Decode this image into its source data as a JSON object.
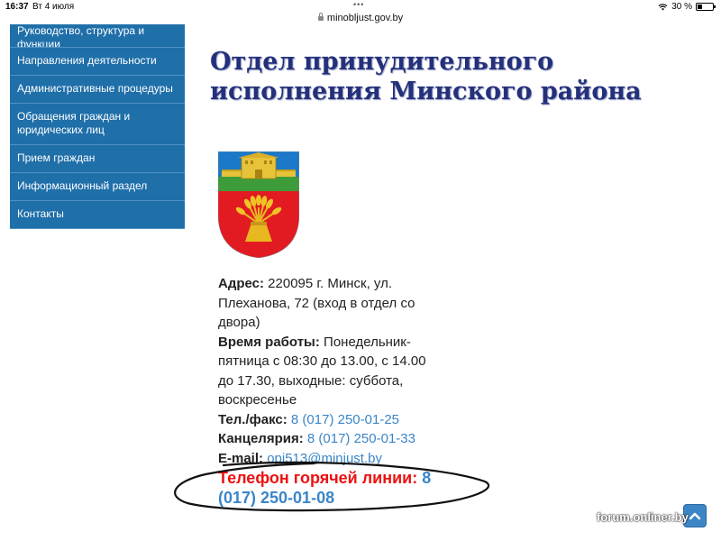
{
  "status_bar": {
    "time": "16:37",
    "date": "Вт 4 июля",
    "battery": "30 %",
    "battery_level": 0.3
  },
  "browser": {
    "url": "minobljust.gov.by"
  },
  "sidebar": {
    "items": [
      {
        "label": "Руководство, структура и функции"
      },
      {
        "label": "Направления деятельности"
      },
      {
        "label": "Административные процедуры"
      },
      {
        "label": "Обращения граждан и юридических лиц"
      },
      {
        "label": "Прием граждан"
      },
      {
        "label": "Информационный раздел"
      },
      {
        "label": "Контакты"
      }
    ]
  },
  "page": {
    "title": "Отдел принудительного исполнения Минского района",
    "address": {
      "label": "Адрес:",
      "value": "220095 г. Минск, ул. Плеханова, 72 (вход в отдел со двора)"
    },
    "hours": {
      "label": "Время работы:",
      "value": "Понедельник-пятница с 08:30 до 13.00, с 14.00 до 17.30, выходные: суббота, воскресенье"
    },
    "phone_fax": {
      "label": "Тел./факс:",
      "value": "8 (017) 250-01-25"
    },
    "office": {
      "label": "Канцелярия:",
      "value": "8 (017) 250-01-33"
    },
    "email": {
      "label": "E-mail:",
      "value": "opi513@minjust.by"
    },
    "hotline": {
      "label": "Телефон горячей линии:",
      "value": "8 (017) 250-01-08"
    }
  },
  "watermark": "forum.onliner.by",
  "colors": {
    "sidebar": "#1f6fa9",
    "title": "#24307a",
    "link": "#3a86c8",
    "hotline": "#ee1111"
  }
}
